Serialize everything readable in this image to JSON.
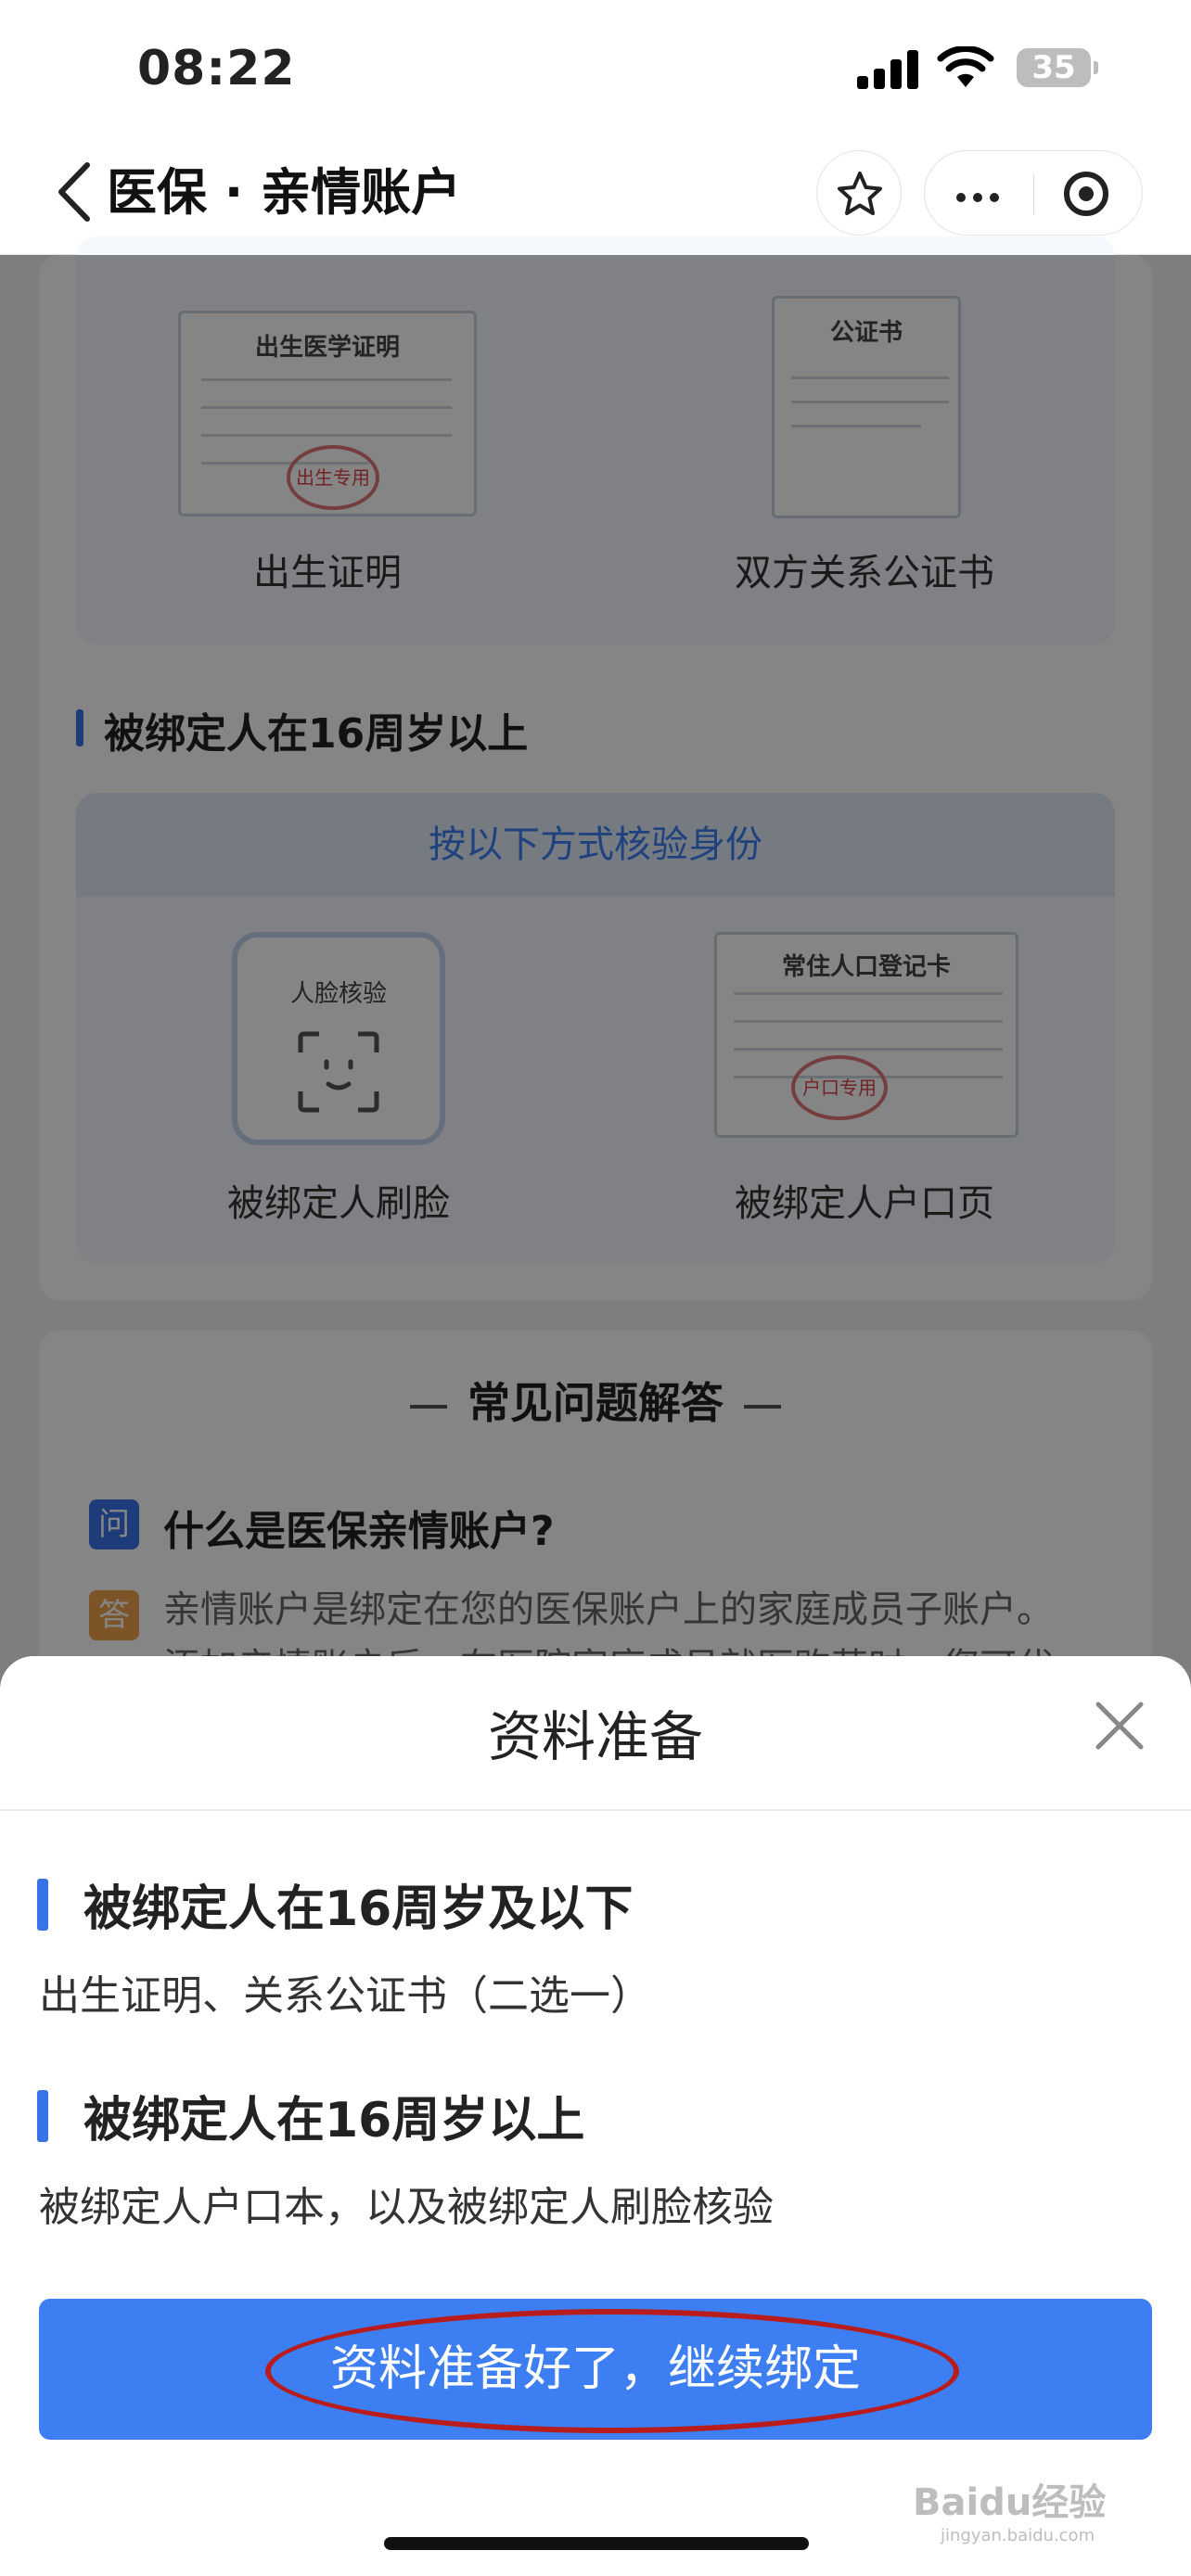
{
  "status_bar": {
    "time": "08:22",
    "battery": "35"
  },
  "nav": {
    "title": "医保 · 亲情账户"
  },
  "background": {
    "doc_birth_title": "出生医学证明",
    "doc_birth_stamp": "出生专用",
    "caption_birth": "出生证明",
    "doc_notary_title": "公证书",
    "caption_notary": "双方关系公证书",
    "section_over16": "被绑定人在16周岁以上",
    "verify_strip": "按以下方式核验身份",
    "face_label": "人脸核验",
    "caption_face": "被绑定人刷脸",
    "doc_household_title": "常住人口登记卡",
    "doc_household_stamp": "户口专用",
    "caption_household": "被绑定人户口页",
    "faq_title": "常见问题解答",
    "q_badge": "问",
    "question": "什么是医保亲情账户?",
    "a_badge": "答",
    "answer_line1": "亲情账户是绑定在您的医保账户上的家庭成员子账户。",
    "answer_line2": "添加亲情账户后，在医院家庭成员就医购药时，您可代"
  },
  "sheet": {
    "title": "资料准备",
    "section1_title": "被绑定人在16周岁及以下",
    "section1_text": "出生证明、关系公证书（二选一）",
    "section2_title": "被绑定人在16周岁以上",
    "section2_text": "被绑定人户口本，以及被绑定人刷脸核验",
    "primary_button": "资料准备好了，继续绑定",
    "watermark": "Baidu经验",
    "watermark_sub": "jingyan.baidu.com"
  },
  "colors": {
    "accent": "#3d7ff2",
    "highlight_ring": "#b91c1c"
  }
}
